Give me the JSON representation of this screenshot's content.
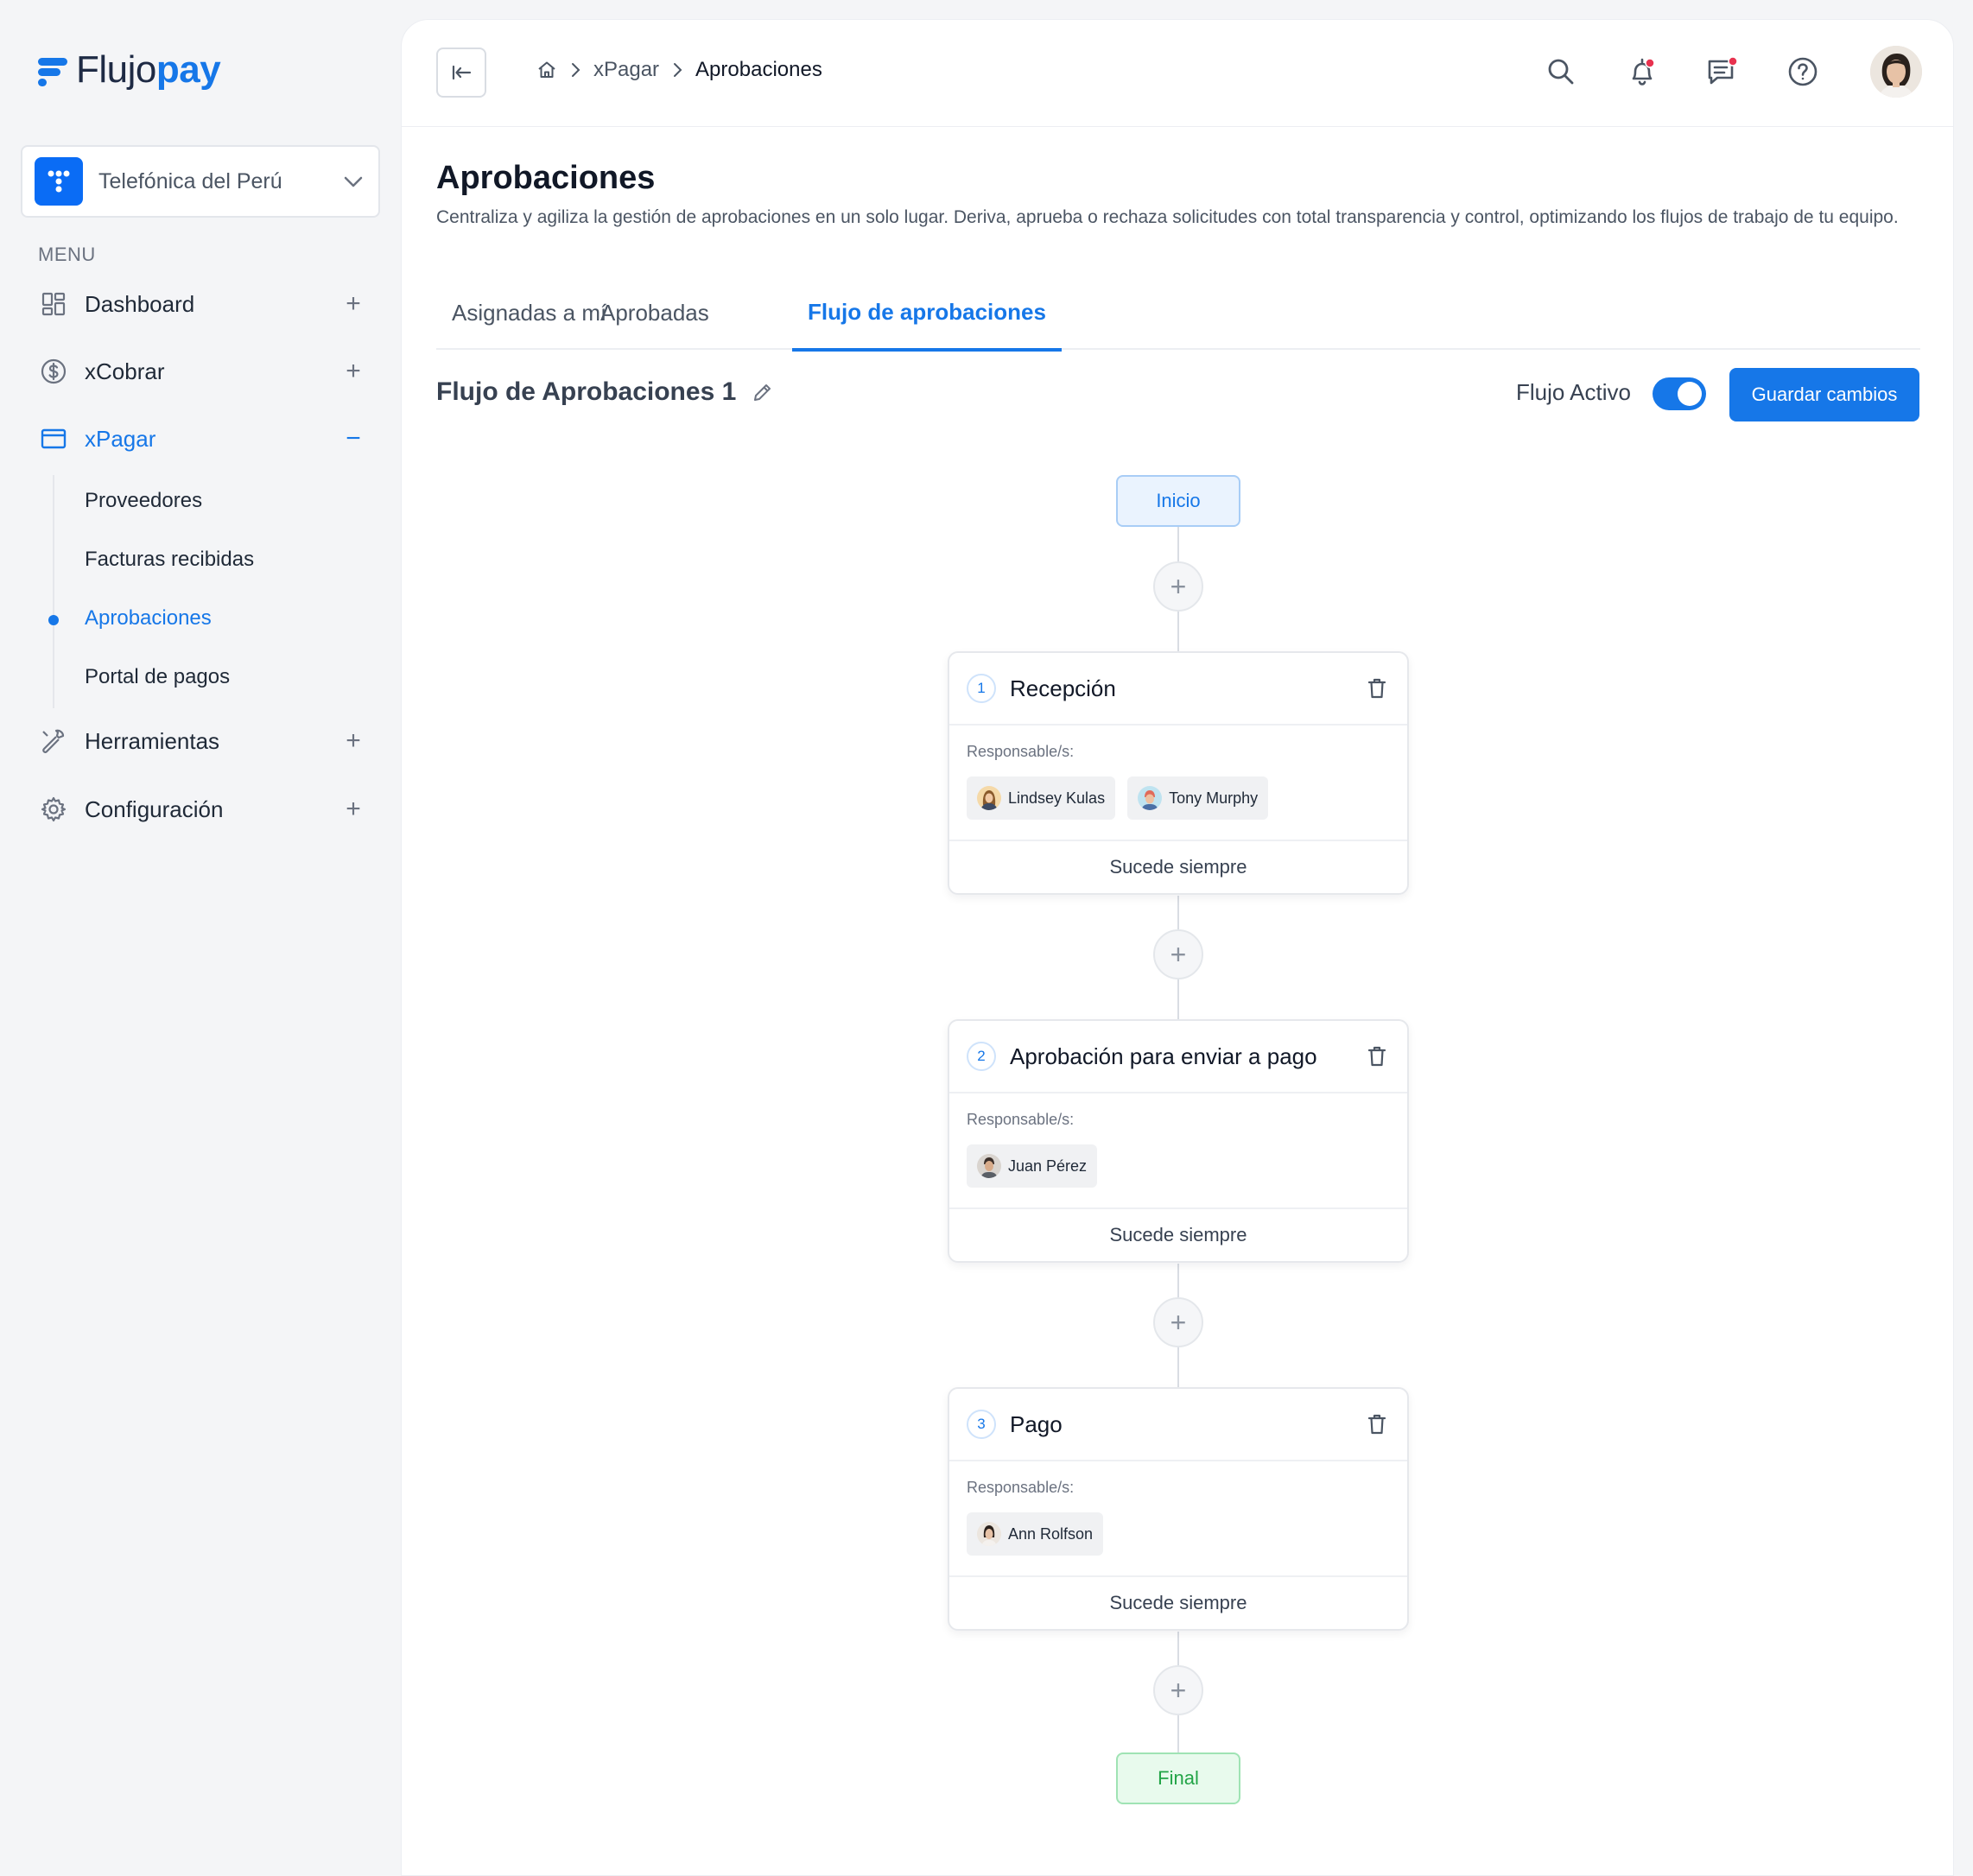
{
  "brand": {
    "name_part1": "Flujo",
    "name_part2": "pay",
    "accent": "#1677e8"
  },
  "company": {
    "name": "Telefónica del Perú"
  },
  "menu": {
    "label": "MENU",
    "items": [
      {
        "label": "Dashboard",
        "icon": "dashboard-icon",
        "toggle": "+"
      },
      {
        "label": "xCobrar",
        "icon": "dollar-icon",
        "toggle": "+"
      },
      {
        "label": "xPagar",
        "icon": "card-icon",
        "toggle": "−"
      },
      {
        "label": "Herramientas",
        "icon": "wrench-icon",
        "toggle": "+"
      },
      {
        "label": "Configuración",
        "icon": "gear-icon",
        "toggle": "+"
      }
    ],
    "subitems": [
      "Proveedores",
      "Facturas recibidas",
      "Aprobaciones",
      "Portal de pagos"
    ]
  },
  "breadcrumb": {
    "items": [
      "xPagar",
      "Aprobaciones"
    ]
  },
  "page": {
    "title": "Aprobaciones",
    "description": "Centraliza y agiliza la gestión de aprobaciones en un solo lugar. Deriva, aprueba o rechaza solicitudes con total transparencia y control, optimizando los flujos de trabajo de tu equipo."
  },
  "tabs": [
    "Asignadas a mí",
    "Aprobadas",
    "Flujo de aprobaciones"
  ],
  "flow": {
    "title": "Flujo de Aprobaciones 1",
    "active_label": "Flujo Activo",
    "active": true,
    "save_label": "Guardar cambios",
    "start_label": "Inicio",
    "end_label": "Final",
    "add_symbol": "+",
    "steps": [
      {
        "number": "1",
        "name": "Recepción",
        "resp_label": "Responsable/s:",
        "responsibles": [
          "Lindsey Kulas",
          "Tony Murphy"
        ],
        "footer": "Sucede siempre"
      },
      {
        "number": "2",
        "name": "Aprobación para enviar a pago",
        "resp_label": "Responsable/s:",
        "responsibles": [
          "Juan Pérez"
        ],
        "footer": "Sucede siempre"
      },
      {
        "number": "3",
        "name": "Pago",
        "resp_label": "Responsable/s:",
        "responsibles": [
          "Ann Rolfson"
        ],
        "footer": "Sucede siempre"
      }
    ]
  }
}
